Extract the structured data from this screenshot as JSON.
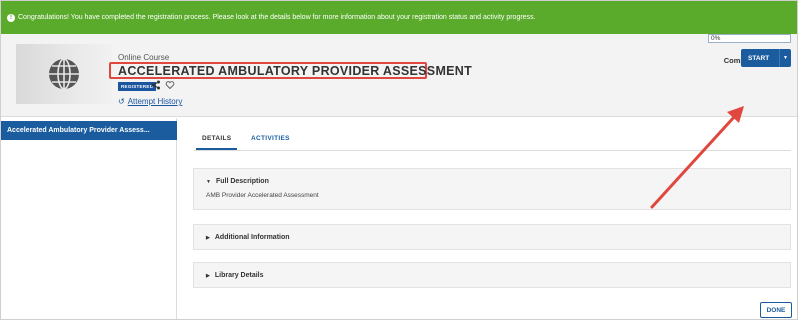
{
  "banner": {
    "icon": "info-circle-icon",
    "text": "Congratulations! You have completed the registration process. Please look at the details below for more information about your registration status and activity progress."
  },
  "course": {
    "type": "Online Course",
    "title": "ACCELERATED AMBULATORY PROVIDER ASSESSMENT",
    "badge": "REGISTERED",
    "attempt_history": "Attempt History",
    "thumbnail_icon": "globe-icon"
  },
  "completion": {
    "label": "Completion Status",
    "value": "0%",
    "progress": 0
  },
  "start_button": {
    "label": "START"
  },
  "sidebar": {
    "items": [
      {
        "label": "Accelerated Ambulatory Provider Assess..."
      }
    ]
  },
  "tabs": [
    {
      "label": "DETAILS"
    },
    {
      "label": "ACTIVITIES"
    }
  ],
  "sections": [
    {
      "title": "Full Description",
      "body": "AMB Provider Accelerated Assessment",
      "expanded": true
    },
    {
      "title": "Additional Information",
      "expanded": false
    },
    {
      "title": "Library Details",
      "expanded": false
    }
  ],
  "done_button": {
    "label": "DONE"
  },
  "colors": {
    "banner": "#5aab2b",
    "primary": "#1a5c9e",
    "highlight": "#e0483f"
  }
}
